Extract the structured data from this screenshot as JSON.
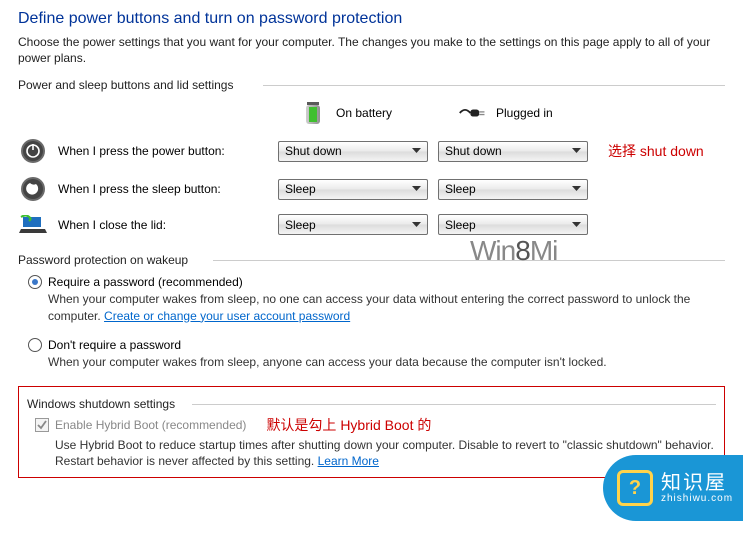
{
  "header": {
    "title": "Define power buttons and turn on password protection",
    "subtitle": "Choose the power settings that you want for your computer. The changes you make to the settings on this page apply to all of your power plans."
  },
  "buttons_group": {
    "label": "Power and sleep buttons and lid settings",
    "col_battery": "On battery",
    "col_plugged": "Plugged in",
    "rows": {
      "power": {
        "label": "When I press the power button:",
        "battery": "Shut down",
        "plugged": "Shut down",
        "annotation": "选择 shut down"
      },
      "sleep": {
        "label": "When I press the sleep button:",
        "battery": "Sleep",
        "plugged": "Sleep"
      },
      "lid": {
        "label": "When I close the lid:",
        "battery": "Sleep",
        "plugged": "Sleep"
      }
    }
  },
  "password_group": {
    "label": "Password protection on wakeup",
    "require": {
      "label": "Require a password (recommended)",
      "desc_pre": "When your computer wakes from sleep, no one can access your data without entering the correct password to unlock the computer. ",
      "link": "Create or change your user account password"
    },
    "dont": {
      "label": "Don't require a password",
      "desc": "When your computer wakes from sleep, anyone can access your data because the computer isn't locked."
    }
  },
  "shutdown_group": {
    "label": "Windows shutdown settings",
    "hybrid": {
      "label": "Enable Hybrid Boot (recommended)",
      "annotation": "默认是勾上 Hybrid Boot 的",
      "desc_pre": "Use Hybrid Boot to reduce startup times after shutting down your computer. Disable to revert to \"classic shutdown\" behavior. Restart behavior is never affected by this setting. ",
      "link": "Learn More"
    }
  },
  "watermark": {
    "pre": "Win",
    "mid": "8",
    "post": "Mi"
  },
  "badge": {
    "zh": "知识屋",
    "en": "zhishiwu.com"
  }
}
